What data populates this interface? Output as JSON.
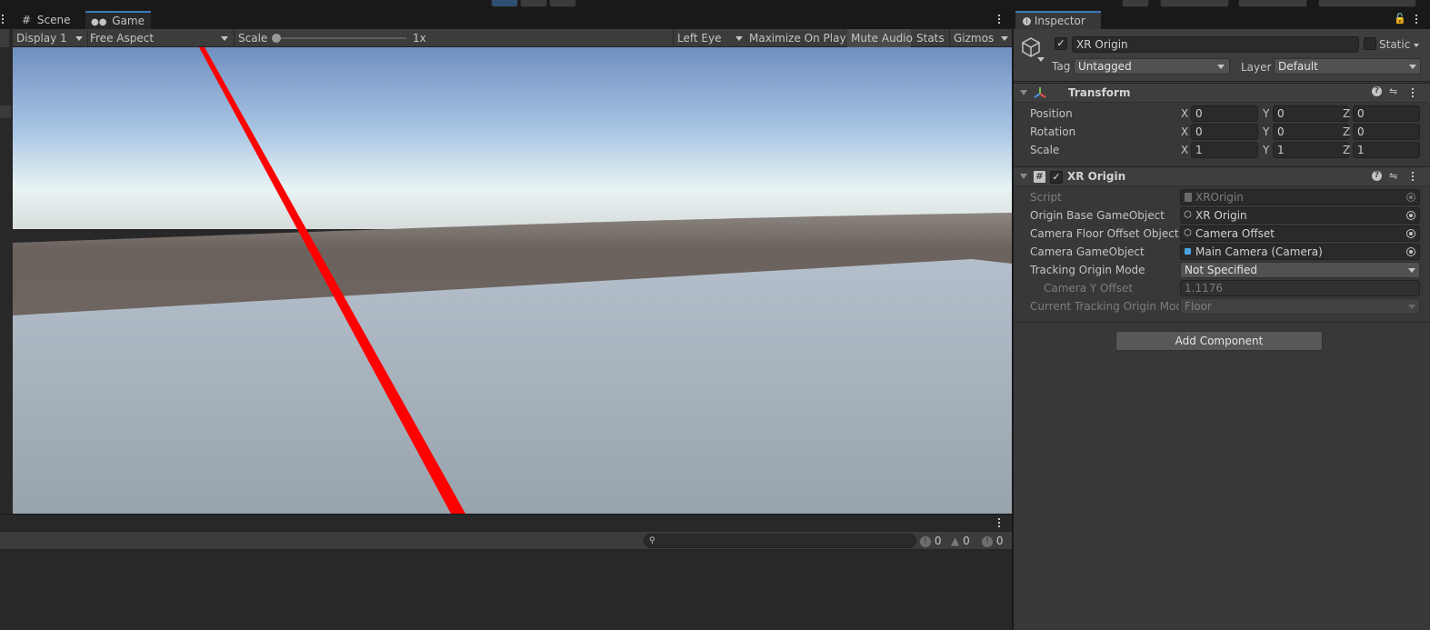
{
  "game_view": {
    "tabs": [
      {
        "label": "Scene"
      },
      {
        "label": "Game"
      }
    ],
    "toolbar": {
      "display": "Display 1",
      "aspect": "Free Aspect",
      "scale_label": "Scale",
      "scale_value": "1x",
      "eye": "Left Eye",
      "maximize": "Maximize On Play",
      "mute": "Mute Audio",
      "stats": "Stats",
      "gizmos": "Gizmos"
    },
    "scene_colors": {
      "sky_top": "#6f8fc0",
      "sky_horizon": "#e8f4f4",
      "ground_far": "#6b625d",
      "floor": "#a3aeb9",
      "ray": "#ff0000"
    }
  },
  "console": {
    "errors": "0",
    "warnings": "0",
    "messages": "0"
  },
  "inspector": {
    "tab_label": "Inspector",
    "object_name": "XR Origin",
    "static_label": "Static",
    "tag_label": "Tag",
    "tag_value": "Untagged",
    "layer_label": "Layer",
    "layer_value": "Default",
    "transform": {
      "title": "Transform",
      "rows": [
        {
          "label": "Position",
          "x": "0",
          "y": "0",
          "z": "0"
        },
        {
          "label": "Rotation",
          "x": "0",
          "y": "0",
          "z": "0"
        },
        {
          "label": "Scale",
          "x": "1",
          "y": "1",
          "z": "1"
        }
      ],
      "axis_x": "X",
      "axis_y": "Y",
      "axis_z": "Z"
    },
    "xr_origin": {
      "title": "XR Origin",
      "script_label": "Script",
      "script_value": "XROrigin",
      "origin_base_label": "Origin Base GameObject",
      "origin_base_value": "XR Origin",
      "camera_floor_label": "Camera Floor Offset Object",
      "camera_floor_value": "Camera Offset",
      "camera_go_label": "Camera GameObject",
      "camera_go_value": "Main Camera (Camera)",
      "tracking_mode_label": "Tracking Origin Mode",
      "tracking_mode_value": "Not Specified",
      "camera_y_label": "Camera Y Offset",
      "camera_y_value": "1.1176",
      "current_mode_label": "Current Tracking Origin Mode",
      "current_mode_value": "Floor"
    },
    "add_component": "Add Component"
  }
}
